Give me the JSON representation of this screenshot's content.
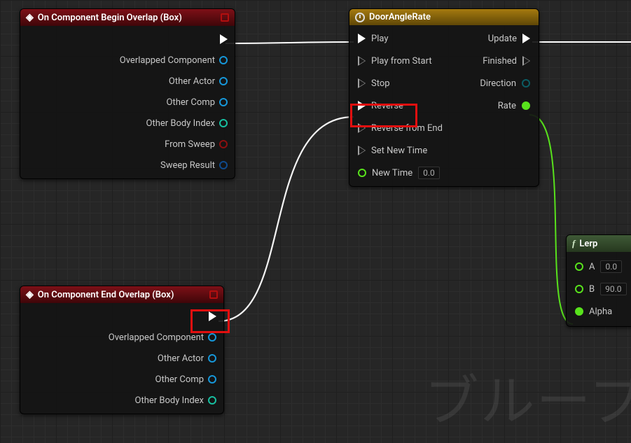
{
  "watermark": "ブループ",
  "nodes": {
    "begin_overlap": {
      "title": "On Component Begin Overlap (Box)",
      "outputs": [
        "Overlapped Component",
        "Other Actor",
        "Other Comp",
        "Other Body Index",
        "From Sweep",
        "Sweep Result"
      ]
    },
    "end_overlap": {
      "title": "On Component End Overlap (Box)",
      "outputs": [
        "Overlapped Component",
        "Other Actor",
        "Other Comp",
        "Other Body Index"
      ]
    },
    "timeline": {
      "title": "DoorAngleRate",
      "inputs": [
        "Play",
        "Play from Start",
        "Stop",
        "Reverse",
        "Reverse from End",
        "Set New Time"
      ],
      "new_time_label": "New Time",
      "new_time_value": "0.0",
      "out_exec": [
        "Update",
        "Finished"
      ],
      "out_data": [
        {
          "label": "Direction",
          "type": "byte"
        },
        {
          "label": "Rate",
          "type": "float"
        }
      ]
    },
    "lerp": {
      "title": "Lerp",
      "a_label": "A",
      "a_value": "0.0",
      "b_label": "B",
      "b_value": "90.0",
      "alpha_label": "Alpha"
    }
  }
}
